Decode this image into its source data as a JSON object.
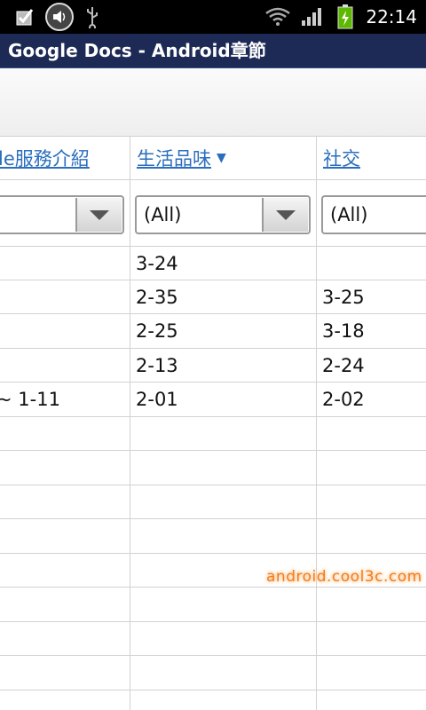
{
  "status_bar": {
    "time": "22:14",
    "icons": [
      "checkbox-notification-icon",
      "volume-icon",
      "usb-icon",
      "wifi-icon",
      "signal-icon",
      "battery-charging-icon"
    ]
  },
  "app": {
    "title": "Google Docs - Android章節"
  },
  "table": {
    "headers": [
      {
        "label": "le服務介紹"
      },
      {
        "label": "生活品味",
        "sorted": true
      },
      {
        "label": "社交"
      }
    ],
    "filters": [
      "",
      "(All)",
      "(All)"
    ],
    "rows": [
      [
        "",
        "3-24",
        ""
      ],
      [
        "",
        "2-35",
        "3-25"
      ],
      [
        "",
        "2-25",
        "3-18"
      ],
      [
        "",
        "2-13",
        "2-24"
      ],
      [
        "~ 1-11",
        "2-01",
        "2-02"
      ]
    ]
  },
  "watermark": "android.cool3c.com",
  "colors": {
    "status_bar": "#000000",
    "title_bar": "#1d2a55",
    "link": "#2a6ebd",
    "grid": "#d2d2d2",
    "watermark": "#f07e20"
  }
}
